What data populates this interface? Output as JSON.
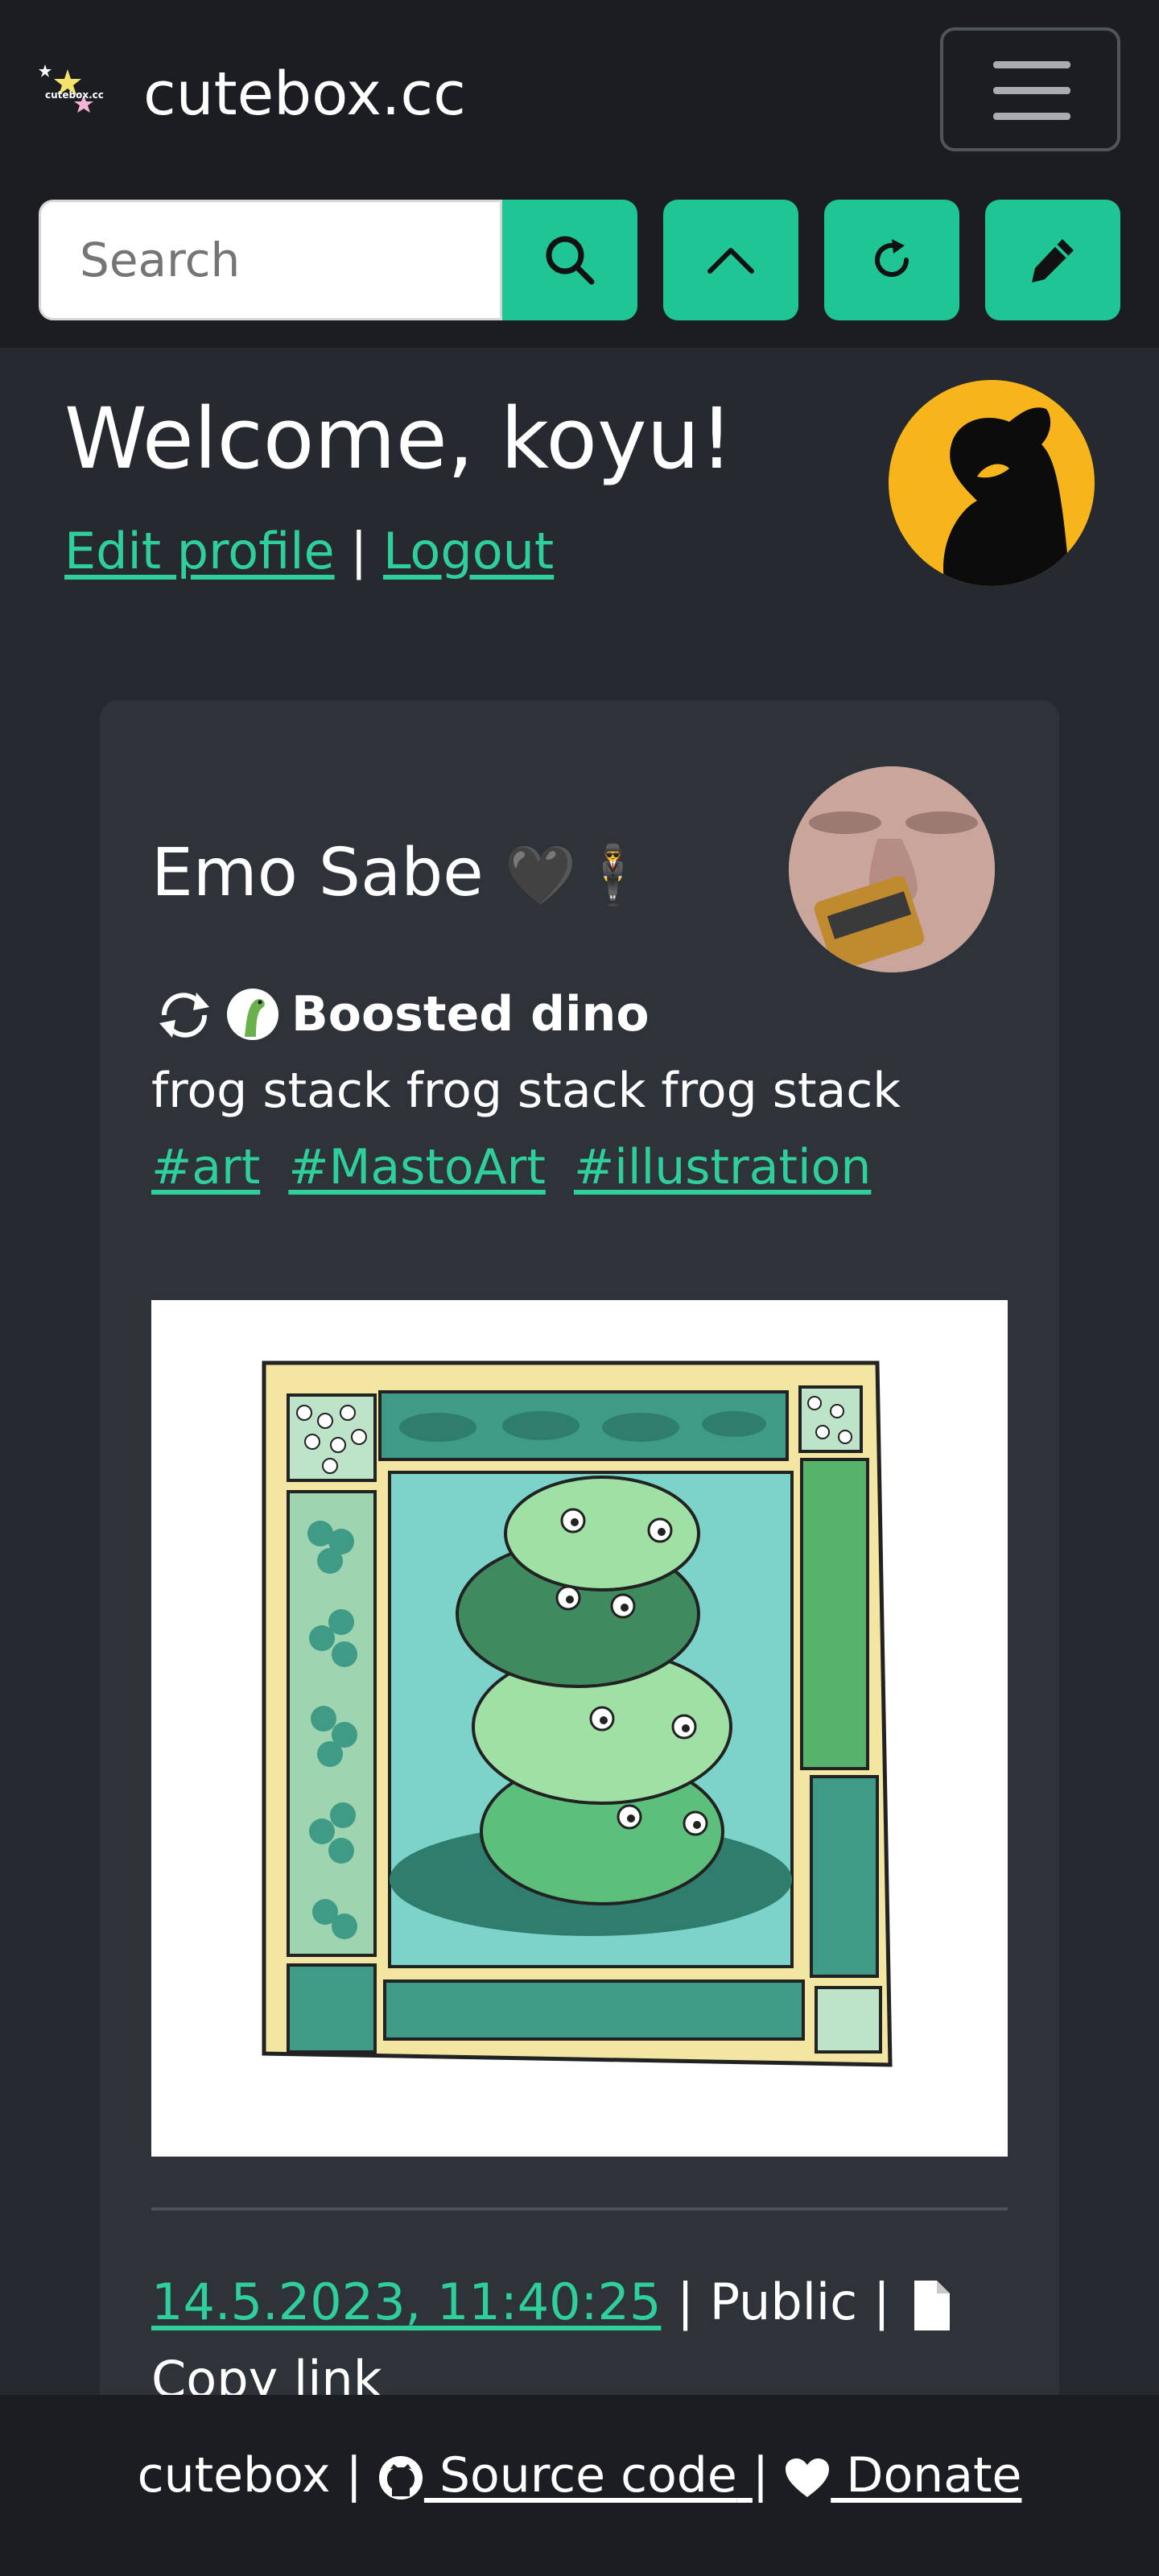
{
  "navbar": {
    "brand": "cutebox.cc",
    "logo_text": "cutebox.cc",
    "menu_icon": "hamburger-menu-icon",
    "search_placeholder": "Search",
    "buttons": [
      {
        "name": "search",
        "icon": "search-icon"
      },
      {
        "name": "scroll-top",
        "icon": "chevron-up-icon"
      },
      {
        "name": "refresh",
        "icon": "refresh-icon"
      },
      {
        "name": "compose",
        "icon": "pencil-icon"
      }
    ],
    "accent_color": "#1fc595"
  },
  "profile": {
    "welcome": "Welcome, koyu!",
    "edit_profile": "Edit profile",
    "separator": "|",
    "logout": "Logout"
  },
  "post": {
    "author": "Emo Sabe",
    "author_emoji": "🖤🕴",
    "boost_prefix_icon": "boost-icon",
    "boosted_by": "Boosted dino",
    "text": "frog stack frog stack frog stack",
    "tags": [
      "#art",
      "#MastoArt",
      "#illustration"
    ],
    "image_alt": "illustration of stacked frogs inside a green and yellow border",
    "timestamp": "14.5.2023, 11:40:25",
    "visibility": "Public",
    "copy_link": "Copy link",
    "separator": "|"
  },
  "footer": {
    "site": "cutebox",
    "separator": "|",
    "source_code": " Source code",
    "donate": " Donate"
  }
}
